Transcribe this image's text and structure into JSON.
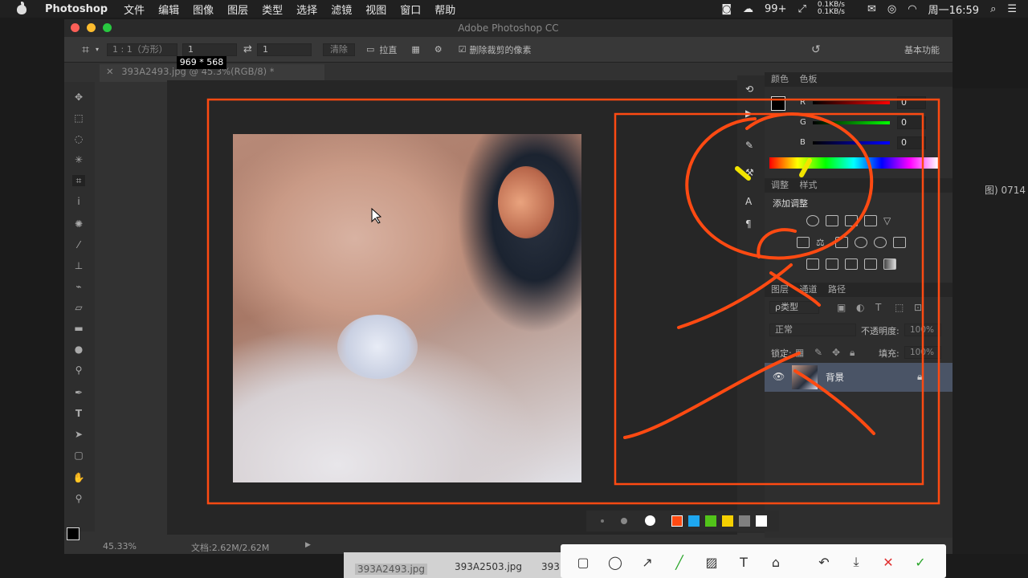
{
  "menubar": {
    "app": "Photoshop",
    "items": [
      "文件",
      "编辑",
      "图像",
      "图层",
      "类型",
      "选择",
      "滤镜",
      "视图",
      "窗口",
      "帮助"
    ],
    "status": {
      "badge": "99+",
      "net_up": "0.1KB/s",
      "net_down": "0.1KB/s",
      "clock": "周一16:59"
    }
  },
  "window": {
    "title": "Adobe Photoshop CC"
  },
  "options": {
    "ratio": "1 : 1（方形）",
    "w": "1",
    "h": "1",
    "clear": "清除",
    "straighten": "拉直",
    "delete_cropped": "删除裁剪的像素",
    "workspace": "基本功能"
  },
  "doc": {
    "tab": "393A2493.jpg @ 45.3%(RGB/8) *",
    "dims": "969 * 568",
    "zoom": "45.33%",
    "docsize": "文档:2.62M/2.62M"
  },
  "color_panel": {
    "tab1": "颜色",
    "tab2": "色板",
    "r_label": "R",
    "g_label": "G",
    "b_label": "B",
    "r": "0",
    "g": "0",
    "b": "0"
  },
  "adjust_panel": {
    "tab1": "调整",
    "tab2": "样式",
    "title": "添加调整"
  },
  "layers_panel": {
    "tab1": "图层",
    "tab2": "通道",
    "tab3": "路径",
    "filter": "ρ类型",
    "blend": "正常",
    "opacity_label": "不透明度:",
    "opacity": "100%",
    "lock_label": "锁定:",
    "fill_label": "填充:",
    "fill": "100%",
    "layer_name": "背景"
  },
  "desktop": {
    "side_text": "图) 0714"
  },
  "thumbs": {
    "a": "393A2493.jpg",
    "b": "393A2503.jpg",
    "c": "393"
  },
  "annotation_colors": {
    "stroke": "#ff4a12",
    "swatches": [
      "#ff4a12",
      "#1ea7f0",
      "#52c41a",
      "#f5d000",
      "#808080",
      "#ffffff"
    ]
  }
}
